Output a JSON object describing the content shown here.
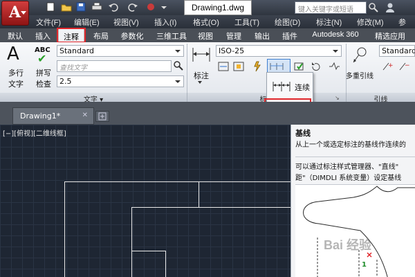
{
  "title_bar": {
    "doc_title": "Drawing1.dwg",
    "search_placeholder": "键入关键字或短语"
  },
  "menu": [
    "文件(F)",
    "编辑(E)",
    "视图(V)",
    "插入(I)",
    "格式(O)",
    "工具(T)",
    "绘图(D)",
    "标注(N)",
    "修改(M)",
    "参"
  ],
  "ribbon_tabs": [
    "默认",
    "插入",
    "注释",
    "布局",
    "参数化",
    "三维工具",
    "视图",
    "管理",
    "输出",
    "插件",
    "Autodesk 360",
    "精选应用"
  ],
  "active_tab": "注释",
  "text_panel": {
    "multiline_label_1": "多行",
    "multiline_label_2": "文字",
    "abc": "ABC",
    "spell_label_1": "拼写",
    "spell_label_2": "检查",
    "style_value": "Standard",
    "find_placeholder": "查找文字",
    "height_value": "2.5",
    "panel_title": "文字 ▾"
  },
  "dimension_panel": {
    "dim_label": "标注",
    "style_value": "ISO-25",
    "panel_title": "标注"
  },
  "leader_panel": {
    "multileader_label": "多重引线",
    "style_value": "Standard",
    "panel_title": "引线"
  },
  "dropdown": {
    "continue_label": "连续",
    "baseline_label": "基线"
  },
  "document_tab": {
    "name": "Drawing1*",
    "close": "✕"
  },
  "viewport_label": "[−][俯视][二维线框]",
  "tooltip": {
    "title": "基线",
    "line1": "从上一个或选定标注的基线作连续的",
    "line2": "可以通过标注样式管理器、\"直线\"",
    "line3": "距\"（DIMDLI 系统变量）设定基线",
    "figure_number": "1"
  },
  "watermark": "Bai 经验",
  "colors": {
    "highlight_red": "#e0262b",
    "canvas_bg": "#1e2633",
    "ribbon_bg": "#eef1f5"
  }
}
